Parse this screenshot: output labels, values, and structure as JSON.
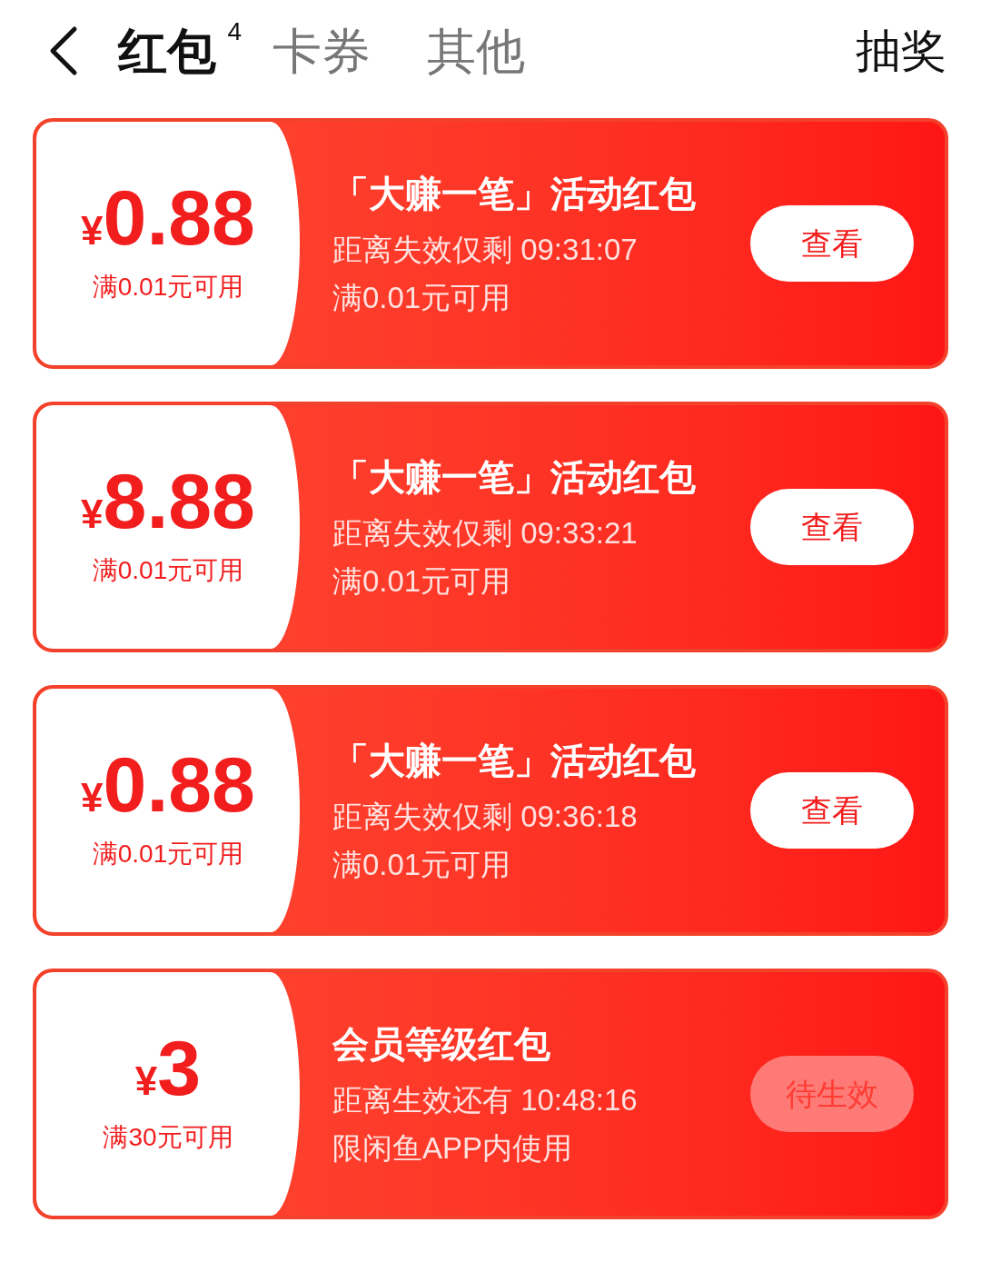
{
  "header": {
    "tabs": [
      {
        "label": "红包",
        "count": "4",
        "selected": true
      },
      {
        "label": "卡券",
        "selected": false
      },
      {
        "label": "其他",
        "selected": false
      }
    ],
    "action": "抽奖"
  },
  "coupons": [
    {
      "currency": "¥",
      "amount": "0.88",
      "condition": "满0.01元可用",
      "title": "「大赚一笔」活动红包",
      "timer": "距离失效仅剩 09:31:07",
      "note": "满0.01元可用",
      "button": {
        "label": "查看",
        "pending": false
      }
    },
    {
      "currency": "¥",
      "amount": "8.88",
      "condition": "满0.01元可用",
      "title": "「大赚一笔」活动红包",
      "timer": "距离失效仅剩 09:33:21",
      "note": "满0.01元可用",
      "button": {
        "label": "查看",
        "pending": false
      }
    },
    {
      "currency": "¥",
      "amount": "0.88",
      "condition": "满0.01元可用",
      "title": "「大赚一笔」活动红包",
      "timer": "距离失效仅剩 09:36:18",
      "note": "满0.01元可用",
      "button": {
        "label": "查看",
        "pending": false
      }
    },
    {
      "currency": "¥",
      "amount": "3",
      "condition": "满30元可用",
      "title": "会员等级红包",
      "timer": "距离生效还有 10:48:16",
      "note": "限闲鱼APP内使用",
      "button": {
        "label": "待生效",
        "pending": true
      }
    }
  ]
}
